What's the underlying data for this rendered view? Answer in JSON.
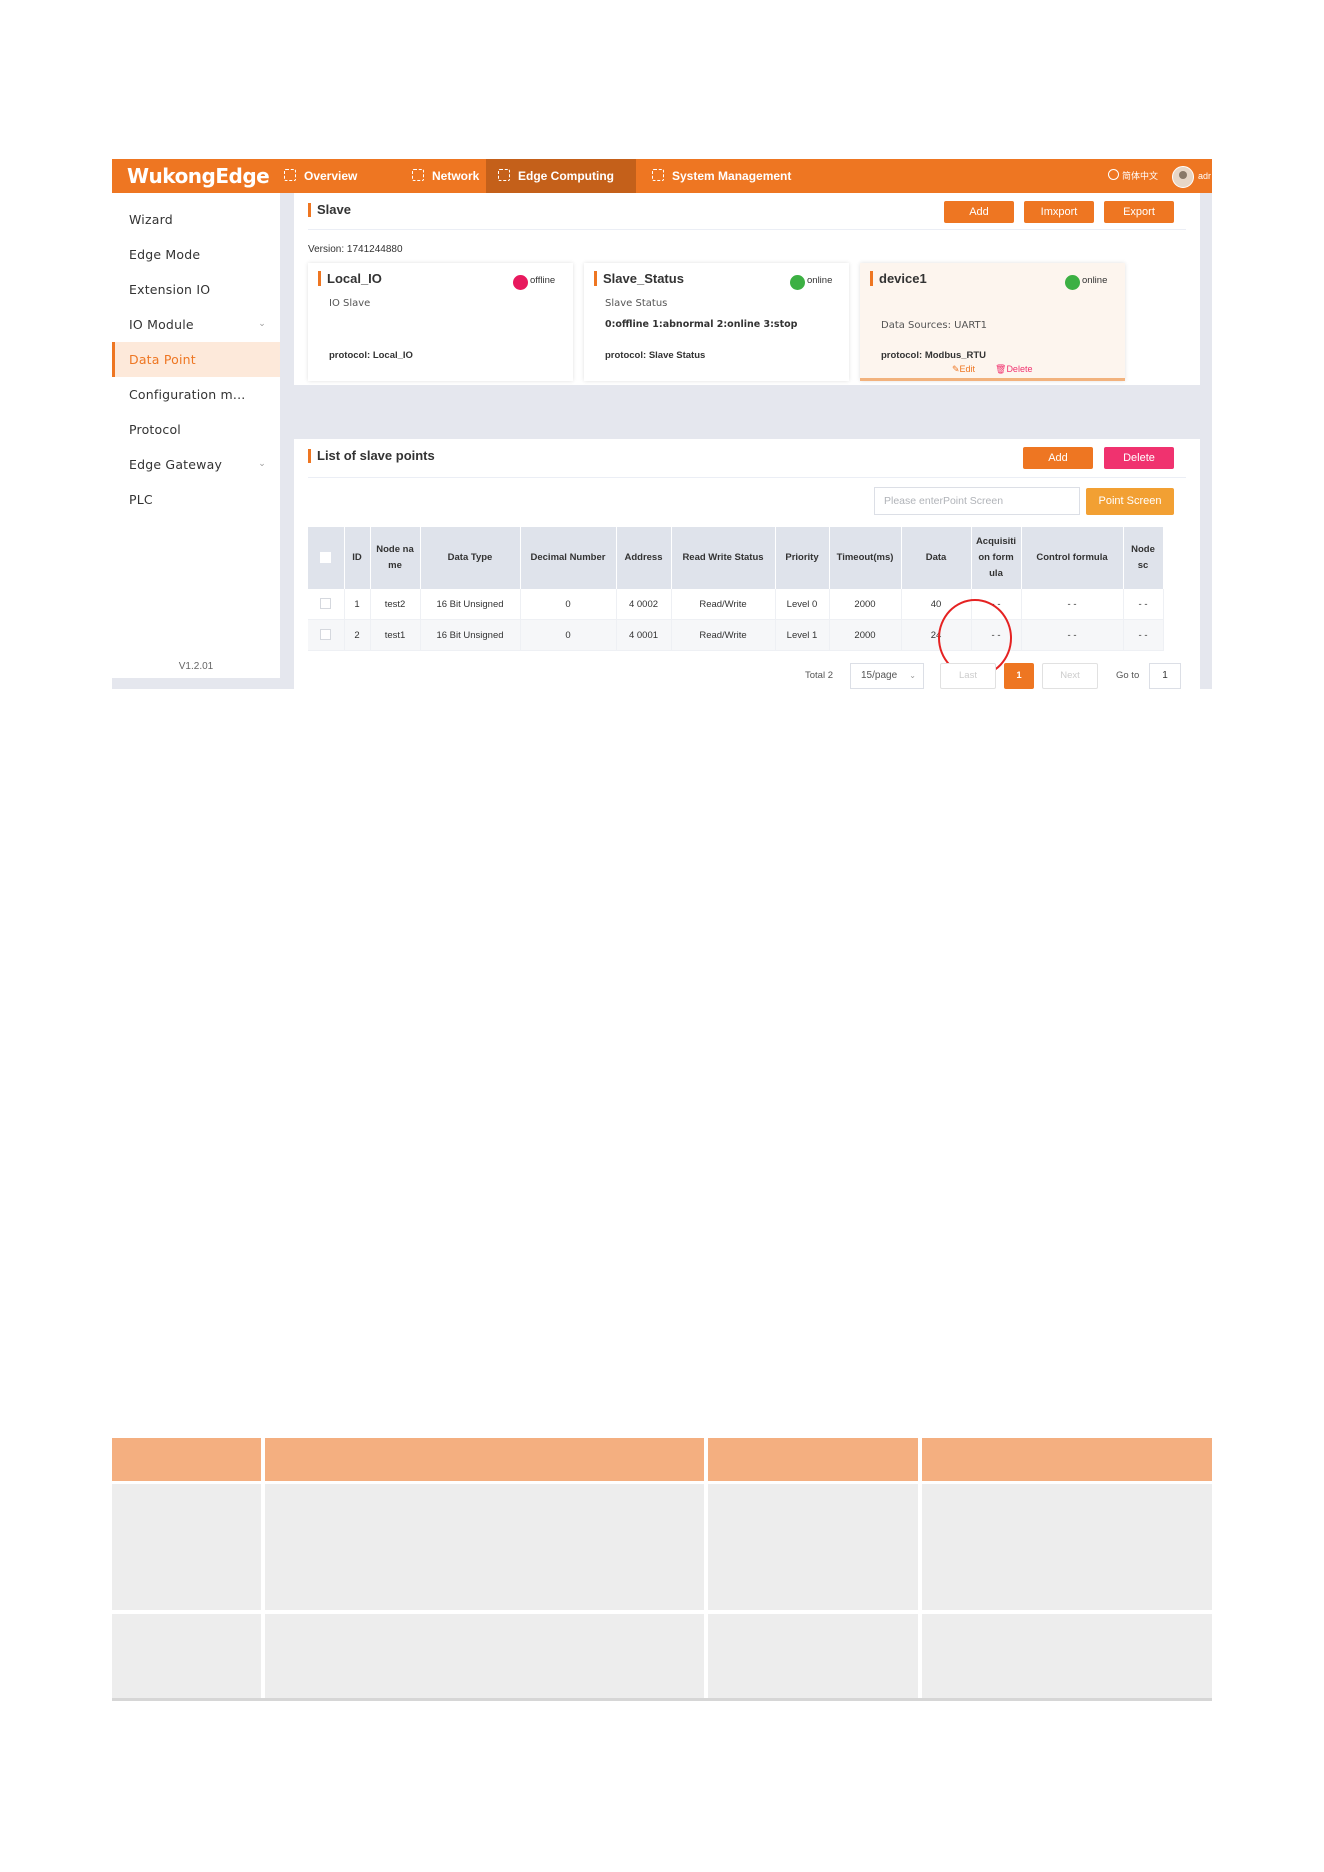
{
  "topbar": {
    "logo": "WukongEdge",
    "nav": [
      {
        "label": "Overview"
      },
      {
        "label": "Network"
      },
      {
        "label": "Edge Computing"
      },
      {
        "label": "System Management"
      }
    ],
    "language": "简体中文",
    "user": "adr"
  },
  "sidebar": {
    "items": [
      {
        "label": "Wizard"
      },
      {
        "label": "Edge Mode"
      },
      {
        "label": "Extension IO"
      },
      {
        "label": "IO Module"
      },
      {
        "label": "Data Point"
      },
      {
        "label": "Configuration m..."
      },
      {
        "label": "Protocol"
      },
      {
        "label": "Edge Gateway"
      },
      {
        "label": "PLC"
      }
    ],
    "version": "V1.2.01"
  },
  "slave": {
    "title": "Slave",
    "buttons": {
      "add": "Add",
      "import": "Imxport",
      "export": "Export"
    },
    "version_label": "Version:",
    "version_value": "1741244880",
    "cards": [
      {
        "name": "Local_IO",
        "status": "offline",
        "status_color": "#e8195e",
        "line1": "IO Slave",
        "line2": "",
        "protocol_label": "protocol:",
        "protocol": "Local_IO"
      },
      {
        "name": "Slave_Status",
        "status": "online",
        "status_color": "#3cb043",
        "line1": "Slave Status",
        "line2": "0:offline 1:abnormal 2:online 3:stop",
        "protocol_label": "protocol:",
        "protocol": "Slave Status"
      },
      {
        "name": "device1",
        "status": "online",
        "status_color": "#3cb043",
        "line1": "Data Sources:  UART1",
        "protocol_label": "protocol:",
        "protocol": "Modbus_RTU",
        "edit": "Edit",
        "delete": "Delete"
      }
    ]
  },
  "points": {
    "title": "List of slave points",
    "buttons": {
      "add": "Add",
      "delete": "Delete"
    },
    "search_placeholder": "Please enterPoint Screen",
    "search_button": "Point Screen",
    "columns": [
      "ID",
      "Node na me",
      "Data Type",
      "Decimal Number",
      "Address",
      "Read Write Status",
      "Priority",
      "Timeout(ms)",
      "Data",
      "Acquisiti on form ula",
      "Control formula",
      "Node sc"
    ],
    "rows": [
      [
        "1",
        "test2",
        "16 Bit Unsigned",
        "0",
        "4 0002",
        "Read/Write",
        "Level 0",
        "2000",
        "40",
        "- -",
        "- -",
        "- -"
      ],
      [
        "2",
        "test1",
        "16 Bit Unsigned",
        "0",
        "4 0001",
        "Read/Write",
        "Level 1",
        "2000",
        "24",
        "- -",
        "- -",
        "- -"
      ]
    ],
    "pagination": {
      "total": "Total 2",
      "page_size": "15/page",
      "prev": "Last",
      "current": "1",
      "next": "Next",
      "goto_label": "Go to",
      "goto_value": "1"
    }
  },
  "colors": {
    "accent": "#ee7622",
    "danger": "#f0326f",
    "gold": "#f2a033",
    "doc_header": "#f4af80",
    "doc_body": "#ededed"
  }
}
